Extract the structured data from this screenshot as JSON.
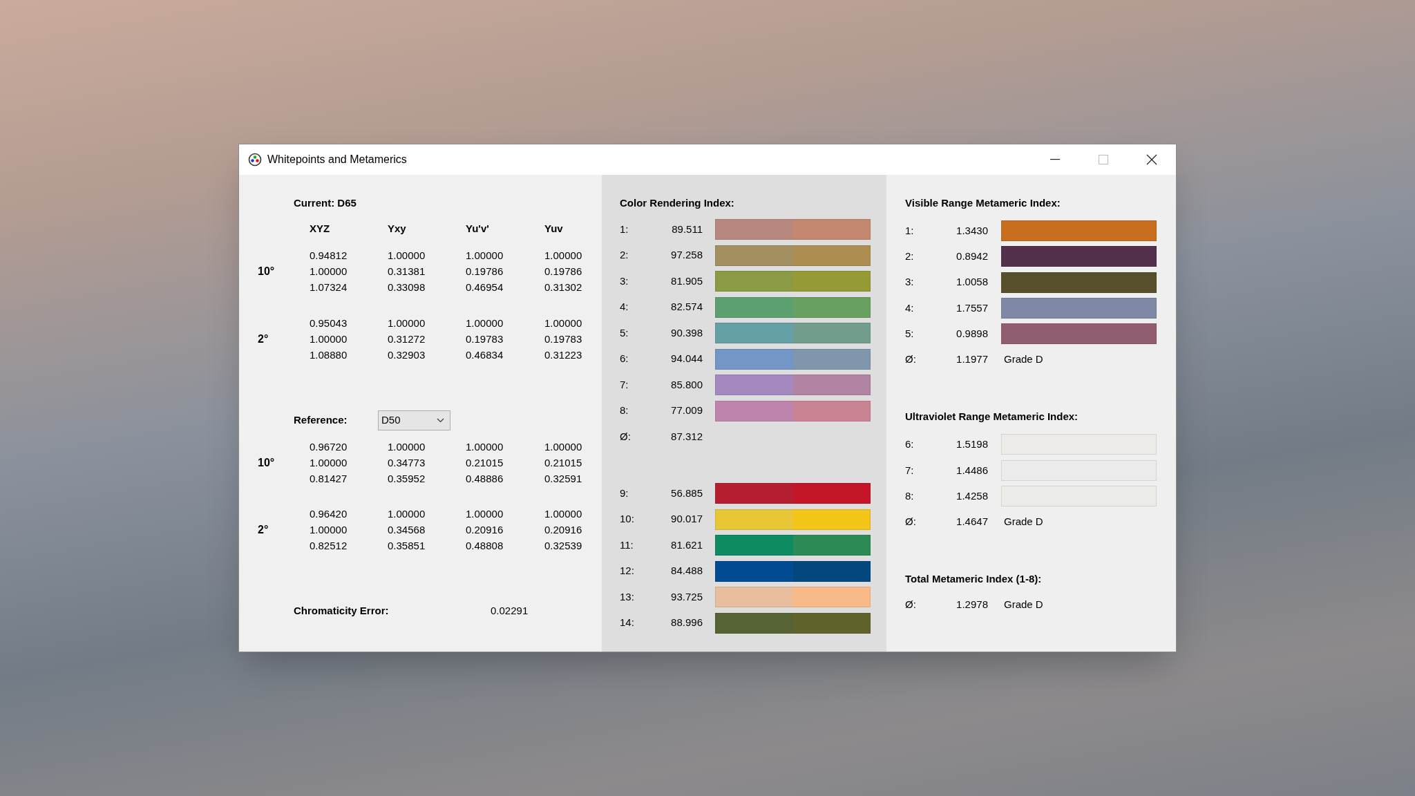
{
  "window": {
    "title": "Whitepoints and Metamerics"
  },
  "current": {
    "label": "Current: D65",
    "columns": [
      "XYZ",
      "Yxy",
      "Yu'v'",
      "Yuv"
    ],
    "blocks": [
      {
        "angle": "10°",
        "rows": [
          [
            "0.94812",
            "1.00000",
            "1.00000",
            "1.00000"
          ],
          [
            "1.00000",
            "0.31381",
            "0.19786",
            "0.19786"
          ],
          [
            "1.07324",
            "0.33098",
            "0.46954",
            "0.31302"
          ]
        ]
      },
      {
        "angle": "2°",
        "rows": [
          [
            "0.95043",
            "1.00000",
            "1.00000",
            "1.00000"
          ],
          [
            "1.00000",
            "0.31272",
            "0.19783",
            "0.19783"
          ],
          [
            "1.08880",
            "0.32903",
            "0.46834",
            "0.31223"
          ]
        ]
      }
    ]
  },
  "reference": {
    "label": "Reference:",
    "dropdown": {
      "value": "D50"
    },
    "blocks": [
      {
        "angle": "10°",
        "rows": [
          [
            "0.96720",
            "1.00000",
            "1.00000",
            "1.00000"
          ],
          [
            "1.00000",
            "0.34773",
            "0.21015",
            "0.21015"
          ],
          [
            "0.81427",
            "0.35952",
            "0.48886",
            "0.32591"
          ]
        ]
      },
      {
        "angle": "2°",
        "rows": [
          [
            "0.96420",
            "1.00000",
            "1.00000",
            "1.00000"
          ],
          [
            "1.00000",
            "0.34568",
            "0.20916",
            "0.20916"
          ],
          [
            "0.82512",
            "0.35851",
            "0.48808",
            "0.32539"
          ]
        ]
      }
    ]
  },
  "chromaticity_error": {
    "label": "Chromaticity Error:",
    "value": "0.02291"
  },
  "color_rendering_index": {
    "title": "Color Rendering Index:",
    "rows": [
      {
        "label": "1:",
        "value": "89.511",
        "swatches": [
          {
            "color": "#b8887e"
          },
          {
            "color": "#c4876f"
          }
        ]
      },
      {
        "label": "2:",
        "value": "97.258",
        "swatches": [
          {
            "color": "#a38f5f"
          },
          {
            "color": "#ad8e50"
          }
        ]
      },
      {
        "label": "3:",
        "value": "81.905",
        "swatches": [
          {
            "color": "#8a9a45"
          },
          {
            "color": "#969a35"
          }
        ]
      },
      {
        "label": "4:",
        "value": "82.574",
        "swatches": [
          {
            "color": "#5ca070"
          },
          {
            "color": "#68a062"
          }
        ]
      },
      {
        "label": "5:",
        "value": "90.398",
        "swatches": [
          {
            "color": "#65a0a6"
          },
          {
            "color": "#729d8c"
          }
        ]
      },
      {
        "label": "6:",
        "value": "94.044",
        "swatches": [
          {
            "color": "#7396c6"
          },
          {
            "color": "#8096ad"
          }
        ]
      },
      {
        "label": "7:",
        "value": "85.800",
        "swatches": [
          {
            "color": "#a389bf"
          },
          {
            "color": "#b084a2"
          }
        ]
      },
      {
        "label": "8:",
        "value": "77.009",
        "swatches": [
          {
            "color": "#be84ad"
          },
          {
            "color": "#c98393"
          }
        ]
      }
    ],
    "average": {
      "label": "Ø:",
      "value": "87.312"
    },
    "extra_rows": [
      {
        "label": "9:",
        "value": "56.885",
        "swatches": [
          {
            "color": "#b51d31"
          },
          {
            "color": "#c51528"
          }
        ]
      },
      {
        "label": "10:",
        "value": "90.017",
        "swatches": [
          {
            "color": "#e8c736"
          },
          {
            "color": "#f3c518"
          }
        ]
      },
      {
        "label": "11:",
        "value": "81.621",
        "swatches": [
          {
            "color": "#0e8b60"
          },
          {
            "color": "#2e8a55"
          }
        ]
      },
      {
        "label": "12:",
        "value": "84.488",
        "swatches": [
          {
            "color": "#004b91"
          },
          {
            "color": "#03477d"
          }
        ]
      },
      {
        "label": "13:",
        "value": "93.725",
        "swatches": [
          {
            "color": "#e9be9f"
          },
          {
            "color": "#f8bb88"
          }
        ]
      },
      {
        "label": "14:",
        "value": "88.996",
        "swatches": [
          {
            "color": "#566435"
          },
          {
            "color": "#5f622b"
          }
        ]
      }
    ]
  },
  "visible_range_metameric_index": {
    "title": "Visible Range Metameric Index:",
    "rows": [
      {
        "label": "1:",
        "value": "1.3430",
        "color": "#c86e1e"
      },
      {
        "label": "2:",
        "value": "0.8942",
        "color": "#52304c"
      },
      {
        "label": "3:",
        "value": "1.0058",
        "color": "#58502c"
      },
      {
        "label": "4:",
        "value": "1.7557",
        "color": "#7f89a5"
      },
      {
        "label": "5:",
        "value": "0.9898",
        "color": "#915e71"
      }
    ],
    "average": {
      "label": "Ø:",
      "value": "1.1977",
      "grade": "Grade D"
    }
  },
  "ultraviolet_range_metameric_index": {
    "title": "Ultraviolet Range Metameric Index:",
    "rows": [
      {
        "label": "6:",
        "value": "1.5198",
        "color": "#ecebe7"
      },
      {
        "label": "7:",
        "value": "1.4486",
        "color": "#ecebeb"
      },
      {
        "label": "8:",
        "value": "1.4258",
        "color": "#ebebe8"
      }
    ],
    "average": {
      "label": "Ø:",
      "value": "1.4647",
      "grade": "Grade D"
    }
  },
  "total_metameric_index": {
    "title": "Total Metameric Index (1-8):",
    "average": {
      "label": "Ø:",
      "value": "1.2978",
      "grade": "Grade D"
    }
  }
}
